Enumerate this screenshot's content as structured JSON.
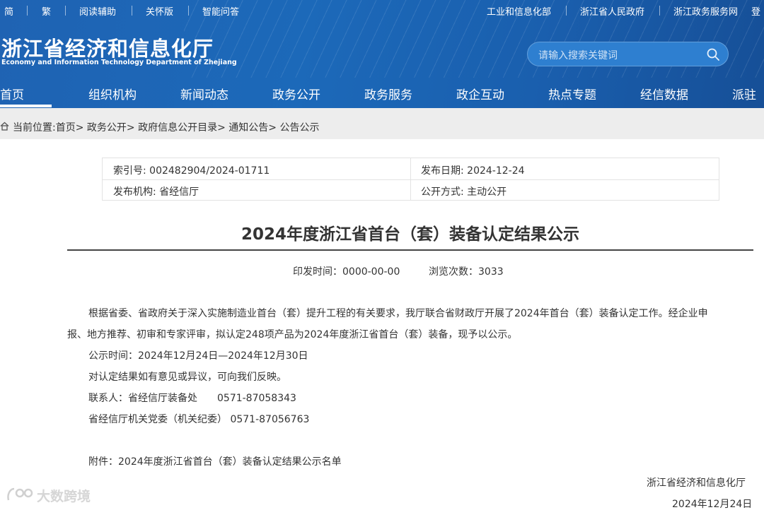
{
  "topbar": {
    "left": [
      "简",
      "繁",
      "阅读辅助",
      "关怀版",
      "智能问答"
    ],
    "right": [
      "工业和信息化部",
      "浙江省人民政府",
      "浙江政务服务网",
      "登"
    ]
  },
  "logo": {
    "cn": "浙江省经济和信息化厅",
    "en": "Economy and Information Technology Department of Zhejiang"
  },
  "search": {
    "placeholder": "请输入搜索关键词"
  },
  "nav": [
    "首页",
    "组织机构",
    "新闻动态",
    "政务公开",
    "政务服务",
    "政企互动",
    "热点专题",
    "经信数据",
    "派驻"
  ],
  "breadcrumb": "当前位置:首页> 政务公开> 政府信息公开目录> 通知公告> 公告公示",
  "meta": {
    "index_no": "索引号: 002482904/2024-01711",
    "publish_date": "发布日期: 2024-12-24",
    "publisher": "发布机构: 省经信厅",
    "open_mode": "公开方式: 主动公开"
  },
  "article": {
    "title": "2024年度浙江省首台（套）装备认定结果公示",
    "print_time": "印发时间：0000-00-00",
    "views": "浏览次数：3033",
    "para1_line1": "根据省委、省政府关于深入实施制造业首台（套）提升工程的有关要求，我厅联合省财政厅开展了2024年首台（套）装备认定工作。经企业申",
    "para1_line2": "报、地方推荐、初审和专家评审，拟认定248项产品为2024年度浙江省首台（套）装备，现予以公示。",
    "period": "公示时间：2024年12月24日—2024年12月30日",
    "feedback": "对认定结果如有意见或异议，可向我们反映。",
    "contact1": "联系人：省经信厅装备处　　0571-87058343",
    "contact2": "省经信厅机关党委（机关纪委）  0571-87056763",
    "attachment": "附件：2024年度浙江省首台（套）装备认定结果公示名单",
    "signature": "浙江省经济和信息化厅",
    "date": "2024年12月24日"
  },
  "watermark": "大数跨境",
  "colors": {
    "header": "#1c69b9",
    "crumb_bg": "#ededed",
    "text": "#333333"
  }
}
